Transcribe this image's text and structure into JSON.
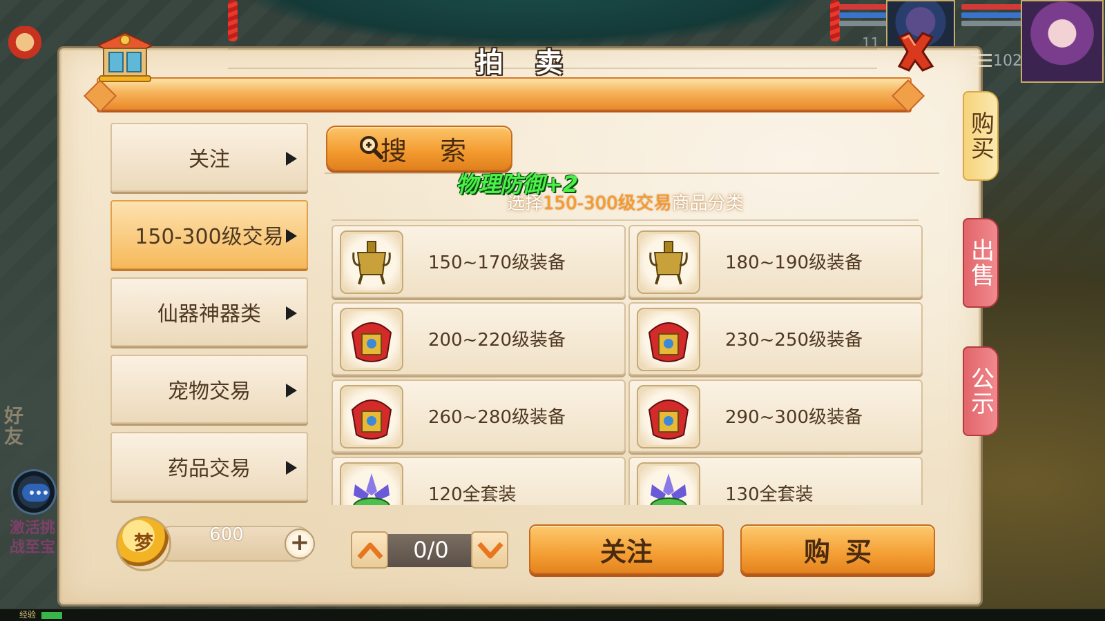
{
  "window": {
    "title": "拍 卖",
    "close_icon": "close-x-icon",
    "shop_icon": "shop-pavilion-icon"
  },
  "sidebar": {
    "items": [
      {
        "label": "关注",
        "active": false
      },
      {
        "label": "150-300级交易",
        "active": true
      },
      {
        "label": "仙器神器类",
        "active": false
      },
      {
        "label": "宠物交易",
        "active": false
      },
      {
        "label": "药品交易",
        "active": false
      }
    ]
  },
  "search": {
    "label": "搜 索",
    "icon": "magnifier-plus-icon"
  },
  "hint": {
    "prefix": "选择",
    "highlight": "150-300级交易",
    "suffix": "商品分类"
  },
  "floating_text": "物理防御+2",
  "items": [
    {
      "name": "150~170级装备",
      "icon": "bronze-ding-icon"
    },
    {
      "name": "180~190级装备",
      "icon": "bronze-ding-icon"
    },
    {
      "name": "200~220级装备",
      "icon": "red-armor-icon"
    },
    {
      "name": "230~250级装备",
      "icon": "red-armor-icon"
    },
    {
      "name": "260~280级装备",
      "icon": "red-armor-icon"
    },
    {
      "name": "290~300级装备",
      "icon": "red-armor-icon"
    },
    {
      "name": "120全套装",
      "icon": "lotus-set-icon"
    },
    {
      "name": "130全套装",
      "icon": "lotus-set-icon"
    }
  ],
  "currency": {
    "coin_symbol": "梦",
    "value": "600",
    "add_label": "+"
  },
  "pager": {
    "value": "0/0"
  },
  "actions": {
    "follow_label": "关注",
    "buy_label": "购买"
  },
  "side_tabs": {
    "buy": "购买",
    "sell": "出售",
    "notice": "公示"
  },
  "hud": {
    "exp_label": "经验",
    "left_side_text": "好友",
    "promo_text": "激活挑战至宝",
    "level_a": "11",
    "level_b": "102"
  },
  "colors": {
    "panel_bg": "#f3e6cd",
    "accent_orange": "#f29a2e",
    "active_tab_red": "#e2656a",
    "hint_highlight": "#ff9a1f",
    "float_green": "#4cf04a"
  }
}
